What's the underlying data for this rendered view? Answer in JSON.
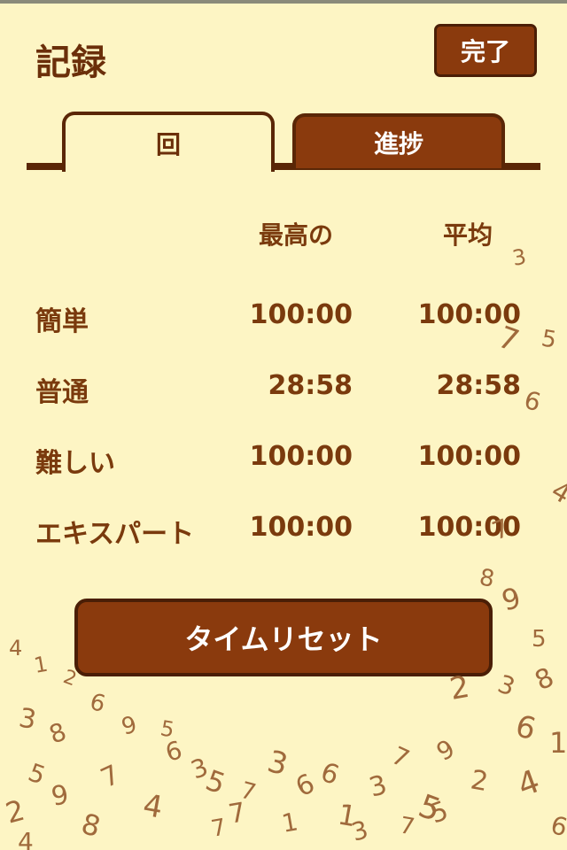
{
  "header": {
    "title": "記録",
    "done_label": "完了"
  },
  "tabs": [
    {
      "label": "回",
      "active": true
    },
    {
      "label": "進捗",
      "active": false
    }
  ],
  "table": {
    "columns": [
      "最高の",
      "平均"
    ],
    "rows": [
      {
        "label": "簡単",
        "best": "100:00",
        "average": "100:00"
      },
      {
        "label": "普通",
        "best": "28:58",
        "average": "28:58"
      },
      {
        "label": "難しい",
        "best": "100:00",
        "average": "100:00"
      },
      {
        "label": "エキスパート",
        "best": "100:00",
        "average": "100:00"
      }
    ]
  },
  "reset_label": "タイムリセット",
  "colors": {
    "background": "#fdf5c4",
    "brown": "#8a3a0d",
    "text": "#7a3a0d"
  },
  "decoration": {
    "scattered_digits": [
      "3",
      "7",
      "5",
      "6",
      "4",
      "7",
      "8",
      "9",
      "5",
      "2",
      "3",
      "8",
      "6",
      "1",
      "4",
      "2",
      "9",
      "5",
      "3",
      "7",
      "1",
      "6"
    ]
  }
}
